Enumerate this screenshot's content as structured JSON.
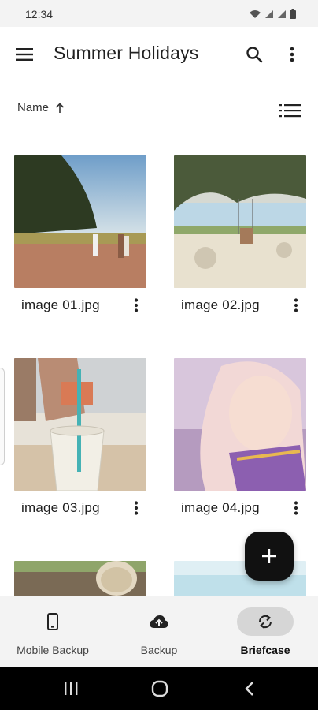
{
  "status_bar": {
    "time": "12:34",
    "icons": [
      "wifi-icon",
      "signal-icon",
      "signal-icon",
      "battery-icon"
    ]
  },
  "app_bar": {
    "title": "Summer Holidays",
    "icons": {
      "menu": "hamburger-menu-icon",
      "search": "search-icon",
      "more": "more-vertical-icon"
    }
  },
  "sort": {
    "label": "Name",
    "direction": "ascending",
    "view_icon": "list-view-icon"
  },
  "files": [
    {
      "name": "image 01.jpg",
      "thumb": "beach walk with trees"
    },
    {
      "name": "image 02.jpg",
      "thumb": "tree swing at beach"
    },
    {
      "name": "image 03.jpg",
      "thumb": "plastic cup with straw"
    },
    {
      "name": "image 04.jpg",
      "thumb": "girl portrait pink tint"
    },
    {
      "name": "",
      "thumb": "child with sun hat"
    },
    {
      "name": "",
      "thumb": "sky and sea"
    }
  ],
  "fab": {
    "icon": "plus-icon"
  },
  "bottom_nav": {
    "items": [
      {
        "label": "Mobile Backup",
        "icon": "phone-icon",
        "active": false
      },
      {
        "label": "Backup",
        "icon": "cloud-upload-icon",
        "active": false
      },
      {
        "label": "Briefcase",
        "icon": "sync-icon",
        "active": true
      }
    ]
  },
  "colors": {
    "fab": "#111111",
    "nav_background": "#f3f3f3",
    "nav_active_pill": "#d6d6d6",
    "system_nav": "#000000"
  }
}
